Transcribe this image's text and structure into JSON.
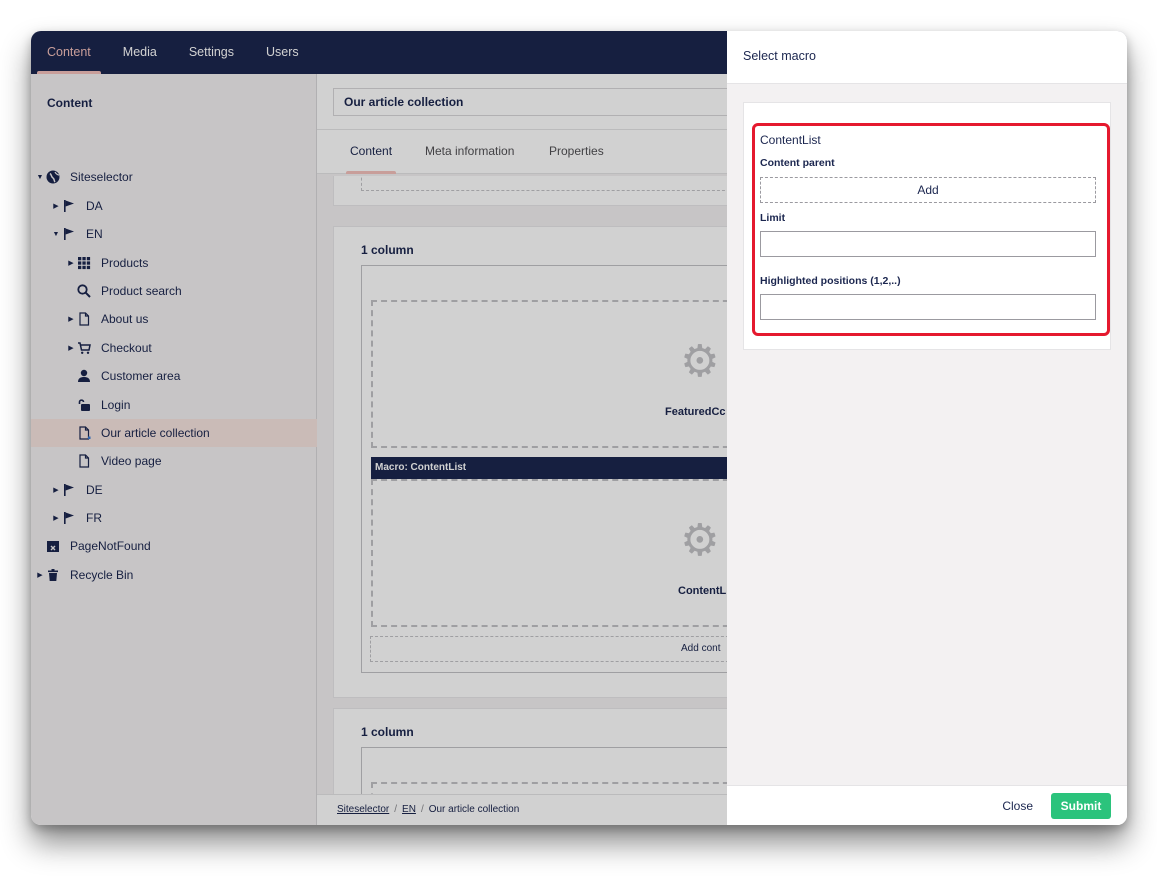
{
  "nav": {
    "items": [
      {
        "label": "Content",
        "active": true
      },
      {
        "label": "Media",
        "active": false
      },
      {
        "label": "Settings",
        "active": false
      },
      {
        "label": "Users",
        "active": false
      }
    ]
  },
  "sidebar": {
    "title": "Content",
    "tree": [
      {
        "label": "Siteselector",
        "icon": "globe-icon",
        "caret": "down"
      },
      {
        "label": "DA",
        "icon": "flag-icon",
        "caret": "right"
      },
      {
        "label": "EN",
        "icon": "flag-icon",
        "caret": "down"
      },
      {
        "label": "Products",
        "icon": "grid-icon",
        "caret": "right"
      },
      {
        "label": "Product search",
        "icon": "search-icon",
        "caret": ""
      },
      {
        "label": "About us",
        "icon": "document-icon",
        "caret": "right"
      },
      {
        "label": "Checkout",
        "icon": "cart-icon",
        "caret": "right"
      },
      {
        "label": "Customer area",
        "icon": "user-icon",
        "caret": ""
      },
      {
        "label": "Login",
        "icon": "unlock-icon",
        "caret": ""
      },
      {
        "label": "Our article collection",
        "icon": "document-icon",
        "caret": "",
        "selected": true
      },
      {
        "label": "Video page",
        "icon": "document-icon",
        "caret": ""
      },
      {
        "label": "DE",
        "icon": "flag-icon",
        "caret": "right"
      },
      {
        "label": "FR",
        "icon": "flag-icon",
        "caret": "right"
      },
      {
        "label": "PageNotFound",
        "icon": "calendar-x-icon",
        "caret": ""
      },
      {
        "label": "Recycle Bin",
        "icon": "trash-icon",
        "caret": "right"
      }
    ]
  },
  "editor": {
    "name_value": "Our article collection",
    "tabs": [
      {
        "label": "Content",
        "active": true
      },
      {
        "label": "Meta information",
        "active": false
      },
      {
        "label": "Properties",
        "active": false
      }
    ],
    "column_label_1": "1 column",
    "featured_label": "FeaturedCc",
    "macro_header": "Macro: ContentList",
    "contentlist_label": "ContentL",
    "add_content_label": "Add cont",
    "column_label_2": "1 column"
  },
  "breadcrumb": {
    "items": [
      "Siteselector",
      "EN",
      "Our article collection"
    ],
    "separator": "/"
  },
  "modal": {
    "title": "Select macro",
    "macro_name": "ContentList",
    "content_parent_label": "Content parent",
    "add_label": "Add",
    "limit_label": "Limit",
    "limit_value": "",
    "highlighted_label": "Highlighted positions (1,2,..)",
    "highlighted_value": "",
    "close_label": "Close",
    "submit_label": "Submit"
  },
  "colors": {
    "nav_bg": "#1b264f",
    "accent_pink": "#f5c1bc",
    "submit_green": "#2bc37c",
    "highlight_red": "#e5192e"
  }
}
